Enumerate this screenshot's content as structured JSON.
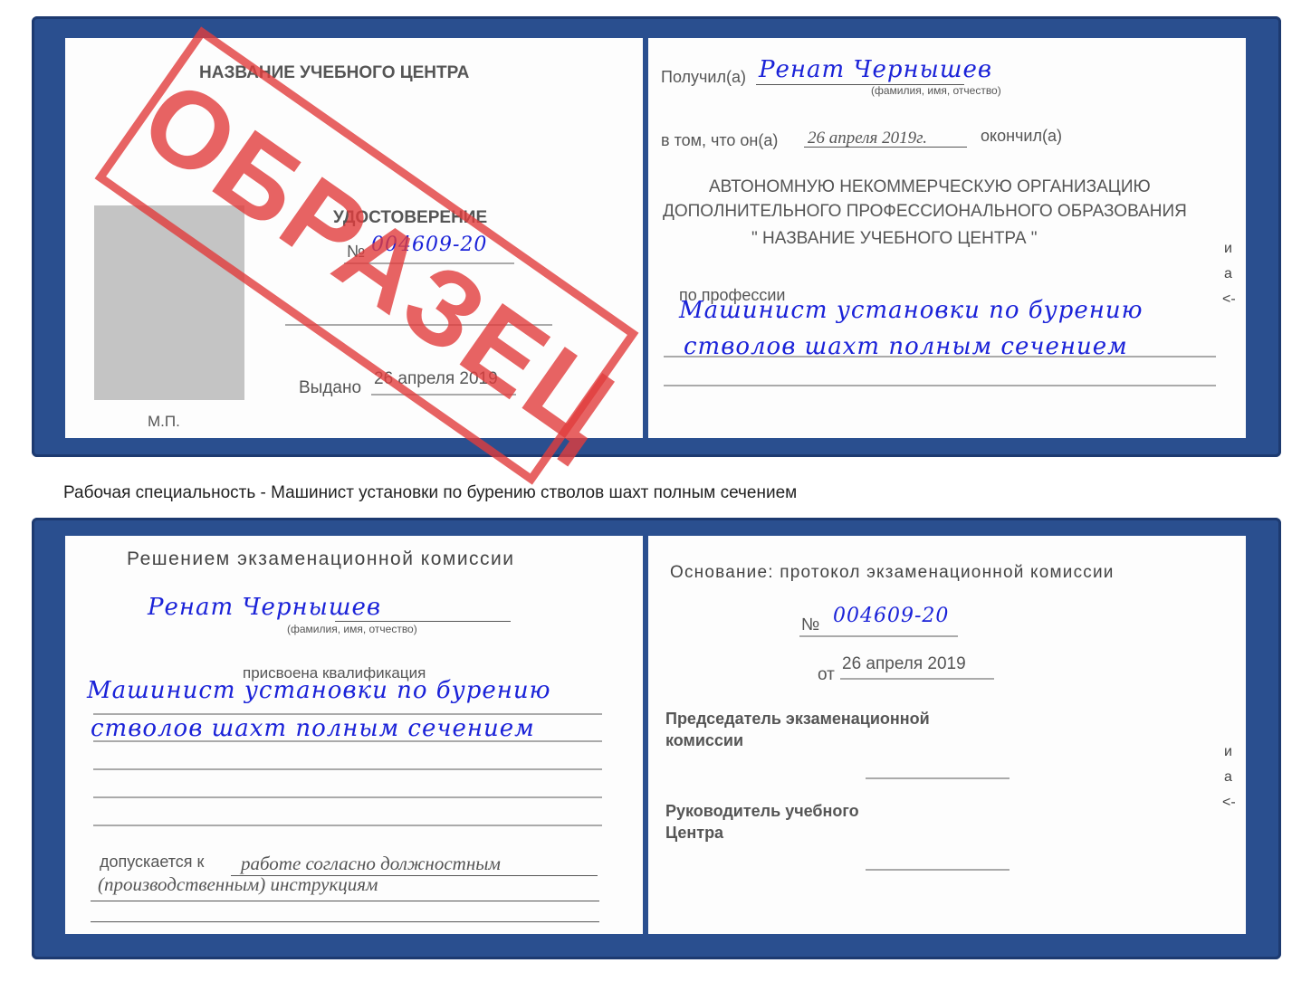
{
  "top": {
    "left": {
      "center_name": "НАЗВАНИЕ УЧЕБНОГО ЦЕНТРА",
      "cert_title": "УДОСТОВЕРЕНИЕ",
      "number_label": "№",
      "number": "004609-20",
      "issued_label": "Выдано",
      "issued_date": "26 апреля 2019",
      "stamp_place": "М.П.",
      "watermark": "ОБРАЗЕЦ"
    },
    "right": {
      "received_label": "Получил(а)",
      "name": "Ренат Чернышев",
      "name_hint": "(фамилия, имя, отчество)",
      "that_label": "в том, что он(а)",
      "date": "26 апреля 2019г.",
      "finished_label": "окончил(а)",
      "org_line1": "АВТОНОМНУЮ НЕКОММЕРЧЕСКУЮ ОРГАНИЗАЦИЮ",
      "org_line2": "ДОПОЛНИТЕЛЬНОГО ПРОФЕССИОНАЛЬНОГО ОБРАЗОВАНИЯ",
      "org_line3": "\"     НАЗВАНИЕ УЧЕБНОГО ЦЕНТРА      \"",
      "profession_label": "по профессии",
      "profession_line1": "Машинист установки по бурению",
      "profession_line2": "стволов шахт полным сечением"
    }
  },
  "caption": "Рабочая специальность - Машинист установки по бурению стволов шахт полным сечением",
  "bottom": {
    "left": {
      "decision": "Решением экзаменационной комиссии",
      "name": "Ренат Чернышев",
      "name_hint": "(фамилия, имя, отчество)",
      "qualification_label": "присвоена квалификация",
      "qual_line1": "Машинист установки по бурению",
      "qual_line2": "стволов шахт полным сечением",
      "admitted_label": "допускается к",
      "admitted_line1": "работе согласно должностным",
      "admitted_line2": "(производственным) инструкциям"
    },
    "right": {
      "basis": "Основание: протокол экзаменационной комиссии",
      "number_label": "№",
      "number": "004609-20",
      "from_label": "от",
      "date": "26 апреля 2019",
      "chair_line1": "Председатель экзаменационной",
      "chair_line2": "комиссии",
      "head_line1": "Руководитель учебного",
      "head_line2": "Центра"
    }
  },
  "edge_marks": [
    "и",
    "а",
    "<-"
  ]
}
